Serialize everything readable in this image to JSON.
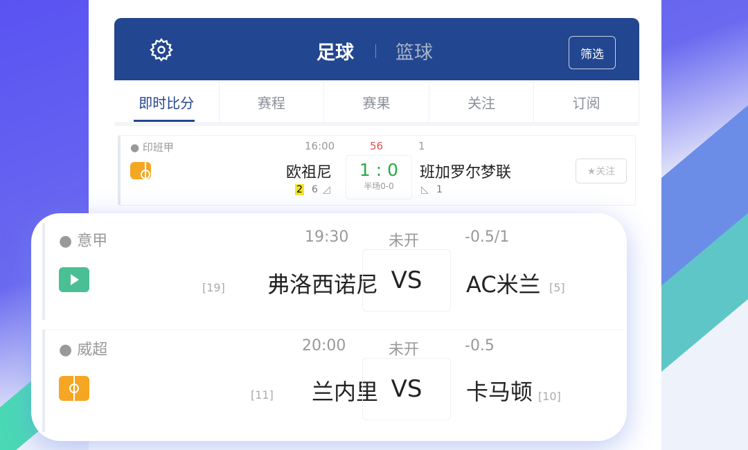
{
  "header": {
    "sports": [
      "足球",
      "篮球"
    ],
    "active_sport": "足球",
    "filter_label": "筛选"
  },
  "tabs": [
    "即时比分",
    "赛程",
    "赛果",
    "关注",
    "订阅"
  ],
  "active_tab": "即时比分",
  "colors": {
    "header": "#22468f",
    "score": "#2aa84a",
    "minute": "#e05050",
    "card_yellow": "#f2e42a"
  },
  "matches": [
    {
      "league": "印班甲",
      "time": "16:00",
      "status": "56",
      "handicap": "1",
      "home": "欧祖尼",
      "away": "班加罗尔梦联",
      "score": "1 : 0",
      "halftime": "半场0-0",
      "home_yellow": "2",
      "home_corners": "6",
      "away_corners": "1",
      "follow": "★关注",
      "icon": "pitch-icon"
    },
    {
      "league": "意甲",
      "time": "19:30",
      "status": "未开",
      "handicap": "-0.5/1",
      "home": "弗洛西诺尼",
      "home_rank": "[19]",
      "away": "AC米兰",
      "away_rank": "[5]",
      "vs": "VS",
      "icon": "play-icon"
    },
    {
      "league": "威超",
      "time": "20:00",
      "status": "未开",
      "handicap": "-0.5",
      "home": "兰内里",
      "home_rank": "[11]",
      "away": "卡马顿",
      "away_rank": "[10]",
      "vs": "VS",
      "icon": "pitch-icon"
    }
  ]
}
